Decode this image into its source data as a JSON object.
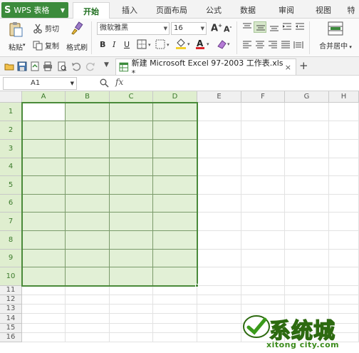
{
  "app_menu": {
    "logo": "S",
    "label": "WPS 表格",
    "caret": "▼"
  },
  "tabs": [
    "开始",
    "插入",
    "页面布局",
    "公式",
    "数据",
    "审阅",
    "视图",
    "特"
  ],
  "ribbon": {
    "cut": "剪切",
    "paste": "粘贴",
    "copy": "复制",
    "format_painter": "格式刷",
    "font_name": "微软雅黑",
    "font_size": "16",
    "grow_font": "A",
    "shrink_font": "A",
    "bold": "B",
    "italic": "I",
    "underline": "U",
    "merge_center": "合并居中",
    "accent_color": "#3c8b3c",
    "font_color": "#d9242a",
    "fill_color": "#f4d02a"
  },
  "document_tab": {
    "title": "新建 Microsoft Excel 97-2003 工作表.xls *",
    "close": "×",
    "new": "+"
  },
  "formula_bar": {
    "name_box": "A1",
    "fx": "fx"
  },
  "columns": [
    "A",
    "B",
    "C",
    "D",
    "E",
    "F",
    "G",
    "H"
  ],
  "rows": [
    "1",
    "2",
    "3",
    "4",
    "5",
    "6",
    "7",
    "8",
    "9",
    "10",
    "11",
    "12",
    "13",
    "14",
    "15",
    "16"
  ],
  "watermark": {
    "text": "系统城",
    "url": "xitong city.com"
  }
}
